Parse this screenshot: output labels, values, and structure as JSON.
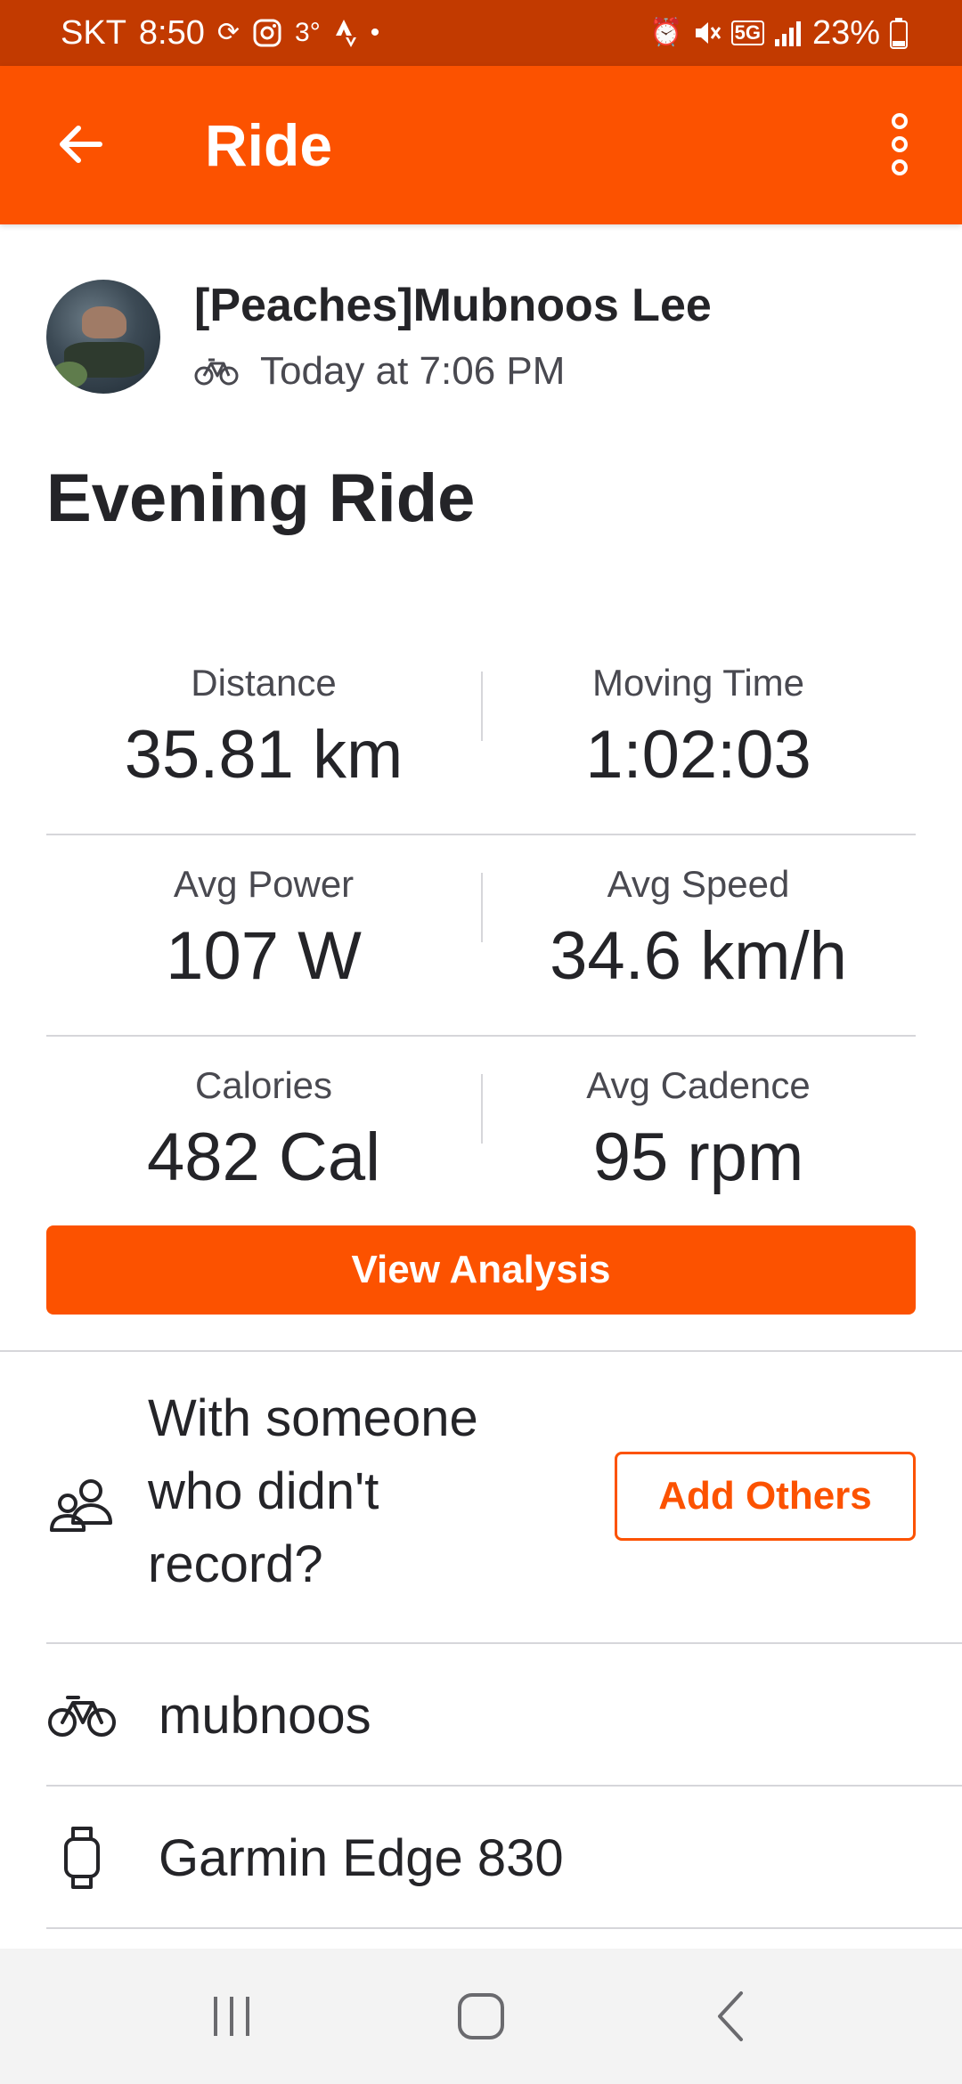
{
  "status_bar": {
    "carrier": "SKT",
    "time": "8:50",
    "temperature": "3°",
    "network": "5G",
    "battery": "23%"
  },
  "app_bar": {
    "title": "Ride"
  },
  "activity": {
    "athlete_name": "[Peaches]Mubnoos Lee",
    "timestamp": "Today at 7:06 PM",
    "title": "Evening Ride"
  },
  "stats": [
    [
      {
        "label": "Distance",
        "value": "35.81 km"
      },
      {
        "label": "Moving Time",
        "value": "1:02:03"
      }
    ],
    [
      {
        "label": "Avg Power",
        "value": "107 W"
      },
      {
        "label": "Avg Speed",
        "value": "34.6 km/h"
      }
    ],
    [
      {
        "label": "Calories",
        "value": "482 Cal"
      },
      {
        "label": "Avg Cadence",
        "value": "95 rpm"
      }
    ]
  ],
  "buttons": {
    "view_analysis": "View Analysis",
    "add_others": "Add Others"
  },
  "with_someone": {
    "text": "With someone who didn't record?"
  },
  "gear": {
    "bike": "mubnoos",
    "device": "Garmin Edge 830"
  },
  "colors": {
    "brand": "#fc5200",
    "status_bar": "#c23a00",
    "text_primary": "#242428",
    "divider": "#d6d6da"
  }
}
